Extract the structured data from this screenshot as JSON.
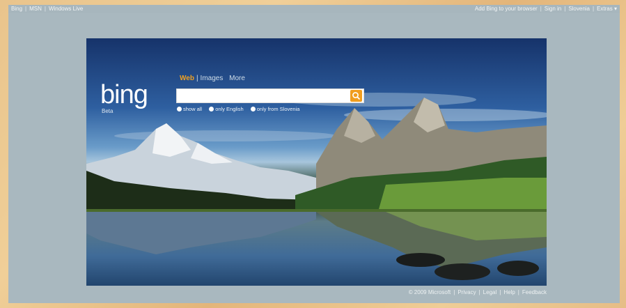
{
  "topbar": {
    "left_links": [
      "Bing",
      "MSN",
      "Windows Live"
    ],
    "right_links": [
      "Add Bing to your browser",
      "Sign in",
      "Slovenia",
      "Extras"
    ],
    "extras_arrow": "▾"
  },
  "logo": {
    "text": "bing",
    "badge": "Beta"
  },
  "scopes": {
    "web": "Web",
    "images": "Images",
    "more": "More"
  },
  "search": {
    "value": "",
    "placeholder": ""
  },
  "options": {
    "show_all": "show all",
    "only_english": "only English",
    "only_from": "only from Slovenia"
  },
  "footer": {
    "copyright": "© 2009 Microsoft",
    "privacy": "Privacy",
    "legal": "Legal",
    "help": "Help",
    "feedback": "Feedback"
  },
  "colors": {
    "accent": "#f09d1e",
    "frame": "#a9b8bf",
    "background": "#e9c48c"
  },
  "icons": {
    "search_button": "search-icon"
  }
}
